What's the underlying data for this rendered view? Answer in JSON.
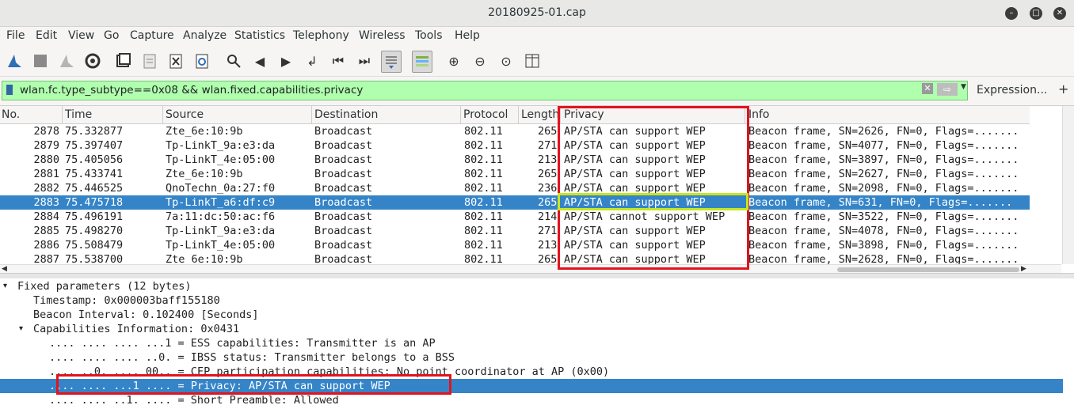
{
  "window": {
    "title": "20180925-01.cap"
  },
  "menu": [
    "File",
    "Edit",
    "View",
    "Go",
    "Capture",
    "Analyze",
    "Statistics",
    "Telephony",
    "Wireless",
    "Tools",
    "Help"
  ],
  "filter": {
    "value": "wlan.fc.type_subtype==0x08 && wlan.fixed.capabilities.privacy",
    "expression_label": "Expression...",
    "plus": "+"
  },
  "columns": [
    "No.",
    "Time",
    "Source",
    "Destination",
    "Protocol",
    "Length",
    "Privacy",
    "Info"
  ],
  "packets": [
    {
      "no": "2878",
      "time": "75.332877",
      "source": "Zte_6e:10:9b",
      "destination": "Broadcast",
      "protocol": "802.11",
      "length": "265",
      "privacy": "AP/STA can support WEP",
      "info": "Beacon frame, SN=2626, FN=0, Flags=.......",
      "selected": false
    },
    {
      "no": "2879",
      "time": "75.397407",
      "source": "Tp-LinkT_9a:e3:da",
      "destination": "Broadcast",
      "protocol": "802.11",
      "length": "271",
      "privacy": "AP/STA can support WEP",
      "info": "Beacon frame, SN=4077, FN=0, Flags=.......",
      "selected": false
    },
    {
      "no": "2880",
      "time": "75.405056",
      "source": "Tp-LinkT_4e:05:00",
      "destination": "Broadcast",
      "protocol": "802.11",
      "length": "213",
      "privacy": "AP/STA can support WEP",
      "info": "Beacon frame, SN=3897, FN=0, Flags=.......",
      "selected": false
    },
    {
      "no": "2881",
      "time": "75.433741",
      "source": "Zte_6e:10:9b",
      "destination": "Broadcast",
      "protocol": "802.11",
      "length": "265",
      "privacy": "AP/STA can support WEP",
      "info": "Beacon frame, SN=2627, FN=0, Flags=.......",
      "selected": false
    },
    {
      "no": "2882",
      "time": "75.446525",
      "source": "QnoTechn_0a:27:f0",
      "destination": "Broadcast",
      "protocol": "802.11",
      "length": "236",
      "privacy": "AP/STA can support WEP",
      "info": "Beacon frame, SN=2098, FN=0, Flags=.......",
      "selected": false
    },
    {
      "no": "2883",
      "time": "75.475718",
      "source": "Tp-LinkT_a6:df:c9",
      "destination": "Broadcast",
      "protocol": "802.11",
      "length": "265",
      "privacy": "AP/STA can support WEP",
      "info": "Beacon frame, SN=631, FN=0, Flags=.......",
      "selected": true
    },
    {
      "no": "2884",
      "time": "75.496191",
      "source": "7a:11:dc:50:ac:f6",
      "destination": "Broadcast",
      "protocol": "802.11",
      "length": "214",
      "privacy": "AP/STA cannot support WEP",
      "info": "Beacon frame, SN=3522, FN=0, Flags=.......",
      "selected": false
    },
    {
      "no": "2885",
      "time": "75.498270",
      "source": "Tp-LinkT_9a:e3:da",
      "destination": "Broadcast",
      "protocol": "802.11",
      "length": "271",
      "privacy": "AP/STA can support WEP",
      "info": "Beacon frame, SN=4078, FN=0, Flags=.......",
      "selected": false
    },
    {
      "no": "2886",
      "time": "75.508479",
      "source": "Tp-LinkT_4e:05:00",
      "destination": "Broadcast",
      "protocol": "802.11",
      "length": "213",
      "privacy": "AP/STA can support WEP",
      "info": "Beacon frame, SN=3898, FN=0, Flags=.......",
      "selected": false
    },
    {
      "no": "2887",
      "time": "75.538700",
      "source": "Zte_6e:10:9b",
      "destination": "Broadcast",
      "protocol": "802.11",
      "length": "265",
      "privacy": "AP/STA can support WEP",
      "info": "Beacon frame, SN=2628, FN=0, Flags=.......",
      "selected": false
    }
  ],
  "details": [
    {
      "text": "Fixed parameters (12 bytes)",
      "level": 0,
      "expanded": true,
      "selected": false
    },
    {
      "text": "Timestamp: 0x000003baff155180",
      "level": 1,
      "expanded": null,
      "selected": false
    },
    {
      "text": "Beacon Interval: 0.102400 [Seconds]",
      "level": 1,
      "expanded": null,
      "selected": false
    },
    {
      "text": "Capabilities Information: 0x0431",
      "level": 1,
      "expanded": true,
      "selected": false
    },
    {
      "text": ".... .... .... ...1 = ESS capabilities: Transmitter is an AP",
      "level": 2,
      "expanded": null,
      "selected": false
    },
    {
      "text": ".... .... .... ..0. = IBSS status: Transmitter belongs to a BSS",
      "level": 2,
      "expanded": null,
      "selected": false
    },
    {
      "text": ".... ..0. .... 00.. = CFP participation capabilities: No point coordinator at AP (0x00)",
      "level": 2,
      "expanded": null,
      "selected": false
    },
    {
      "text": ".... .... ...1 .... = Privacy: AP/STA can support WEP",
      "level": 2,
      "expanded": null,
      "selected": true
    },
    {
      "text": ".... .... ..1. .... = Short Preamble: Allowed",
      "level": 2,
      "expanded": null,
      "selected": false
    }
  ],
  "colors": {
    "selection": "#3584c8",
    "filter_valid": "#afffaf",
    "annotation_red": "#e2131e",
    "annotation_green": "#c8e61e"
  }
}
